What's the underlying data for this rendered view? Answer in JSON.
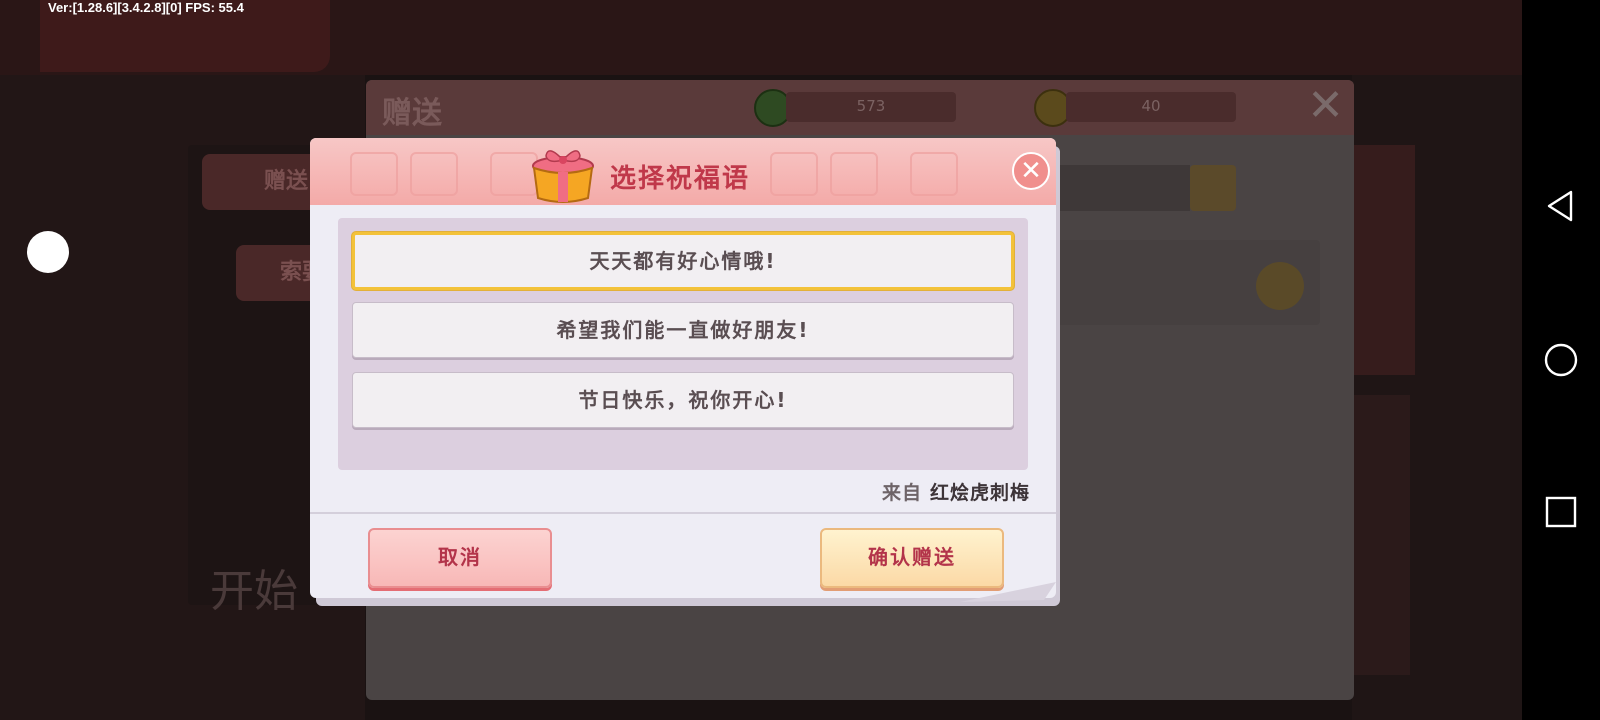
{
  "debug": {
    "text": "Ver:[1.28.6][3.4.2.8][0] FPS: 55.4"
  },
  "background": {
    "window_title": "赠送",
    "currency_green": "573",
    "currency_gold": "40",
    "tab_send": "赠送",
    "tab_request": "索要",
    "start_text": "开始"
  },
  "dialog": {
    "title": "选择祝福语",
    "options": [
      {
        "text": "天天都有好心情哦!",
        "selected": true
      },
      {
        "text": "希望我们能一直做好朋友!",
        "selected": false
      },
      {
        "text": "节日快乐，祝你开心!",
        "selected": false
      }
    ],
    "from_label": "来自",
    "from_name": "红烩虎刺梅",
    "cancel_label": "取消",
    "confirm_label": "确认赠送",
    "close_symbol": "✕"
  },
  "colors": {
    "title": "#c0384a",
    "header_pink": "#f4aaa8",
    "selected_border": "#f3c23a"
  },
  "icons": [
    "gift-box-icon",
    "close-icon",
    "back-icon",
    "home-icon",
    "recents-icon",
    "search-icon"
  ]
}
